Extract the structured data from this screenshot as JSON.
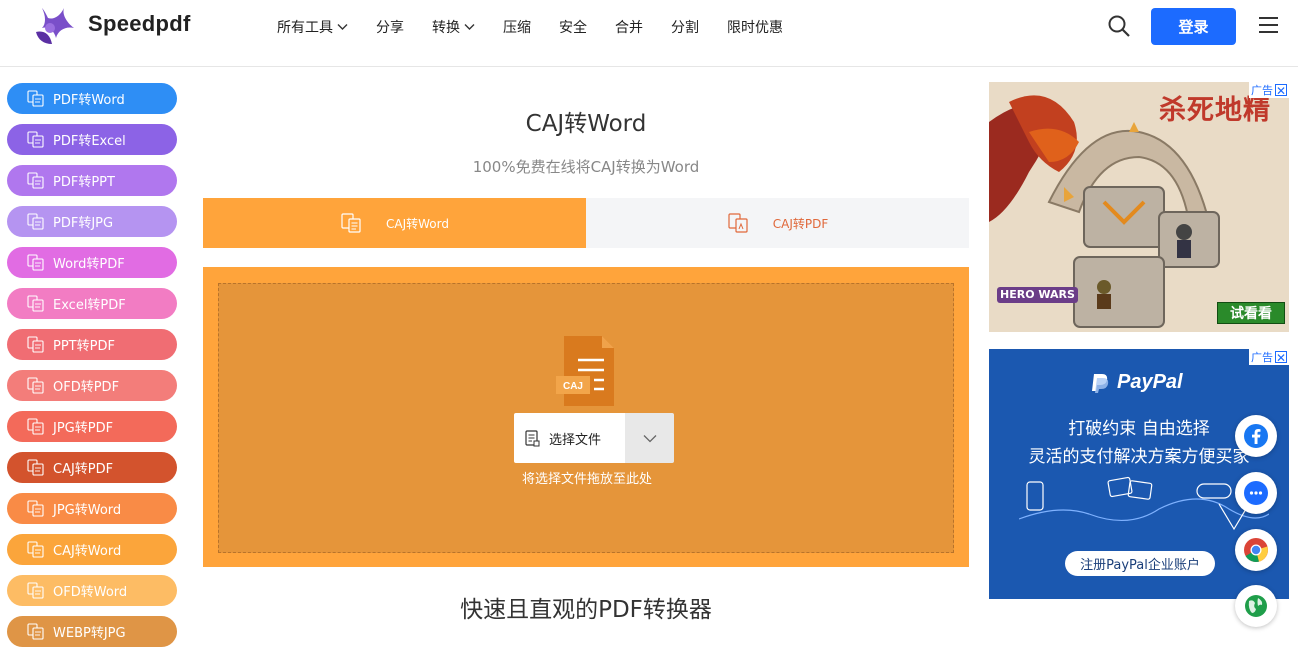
{
  "header": {
    "brand": "Speedpdf",
    "nav": [
      {
        "label": "所有工具",
        "dropdown": true
      },
      {
        "label": "分享",
        "dropdown": false
      },
      {
        "label": "转换",
        "dropdown": true
      },
      {
        "label": "压缩",
        "dropdown": false
      },
      {
        "label": "安全",
        "dropdown": false
      },
      {
        "label": "合并",
        "dropdown": false
      },
      {
        "label": "分割",
        "dropdown": false
      },
      {
        "label": "限时优惠",
        "dropdown": false
      }
    ],
    "login_label": "登录",
    "accent": "#1c6bff"
  },
  "sidebar": {
    "items": [
      {
        "label": "PDF转Word",
        "color": "#2e8ef5"
      },
      {
        "label": "PDF转Excel",
        "color": "#8c63e6"
      },
      {
        "label": "PDF转PPT",
        "color": "#b077ee"
      },
      {
        "label": "PDF转JPG",
        "color": "#b594f1"
      },
      {
        "label": "Word转PDF",
        "color": "#e16ce3"
      },
      {
        "label": "Excel转PDF",
        "color": "#f27cc3"
      },
      {
        "label": "PPT转PDF",
        "color": "#f06d73"
      },
      {
        "label": "OFD转PDF",
        "color": "#f37d7a"
      },
      {
        "label": "JPG转PDF",
        "color": "#f36a5a"
      },
      {
        "label": "CAJ转PDF",
        "color": "#d3532d"
      },
      {
        "label": "JPG转Word",
        "color": "#f98b46"
      },
      {
        "label": "CAJ转Word",
        "color": "#fba53b"
      },
      {
        "label": "OFD转Word",
        "color": "#fdbc64"
      },
      {
        "label": "WEBP转JPG",
        "color": "#df9546"
      }
    ]
  },
  "main": {
    "title": "CAJ转Word",
    "subtitle": "100%免费在线将CAJ转换为Word",
    "tabs": [
      {
        "label": "CAJ转Word",
        "active": true
      },
      {
        "label": "CAJ转PDF",
        "active": false
      }
    ],
    "file_icon_label": "CAJ",
    "choose_label": "选择文件",
    "drop_hint": "将选择文件拖放至此处",
    "bottom_title": "快速且直观的PDF转换器"
  },
  "ads": {
    "ad1": {
      "label": "广告",
      "title": "杀死地精",
      "brand": "HERO WARS",
      "cta": "试看看"
    },
    "ad2": {
      "label": "广告",
      "brand": "PayPal",
      "line1": "打破约束 自由选择",
      "line2": "灵活的支付解决方案方便买家",
      "cta": "注册PayPal企业账户"
    }
  },
  "float_icons": [
    "facebook-icon",
    "messenger-icon",
    "chrome-icon",
    "globe-icon"
  ]
}
